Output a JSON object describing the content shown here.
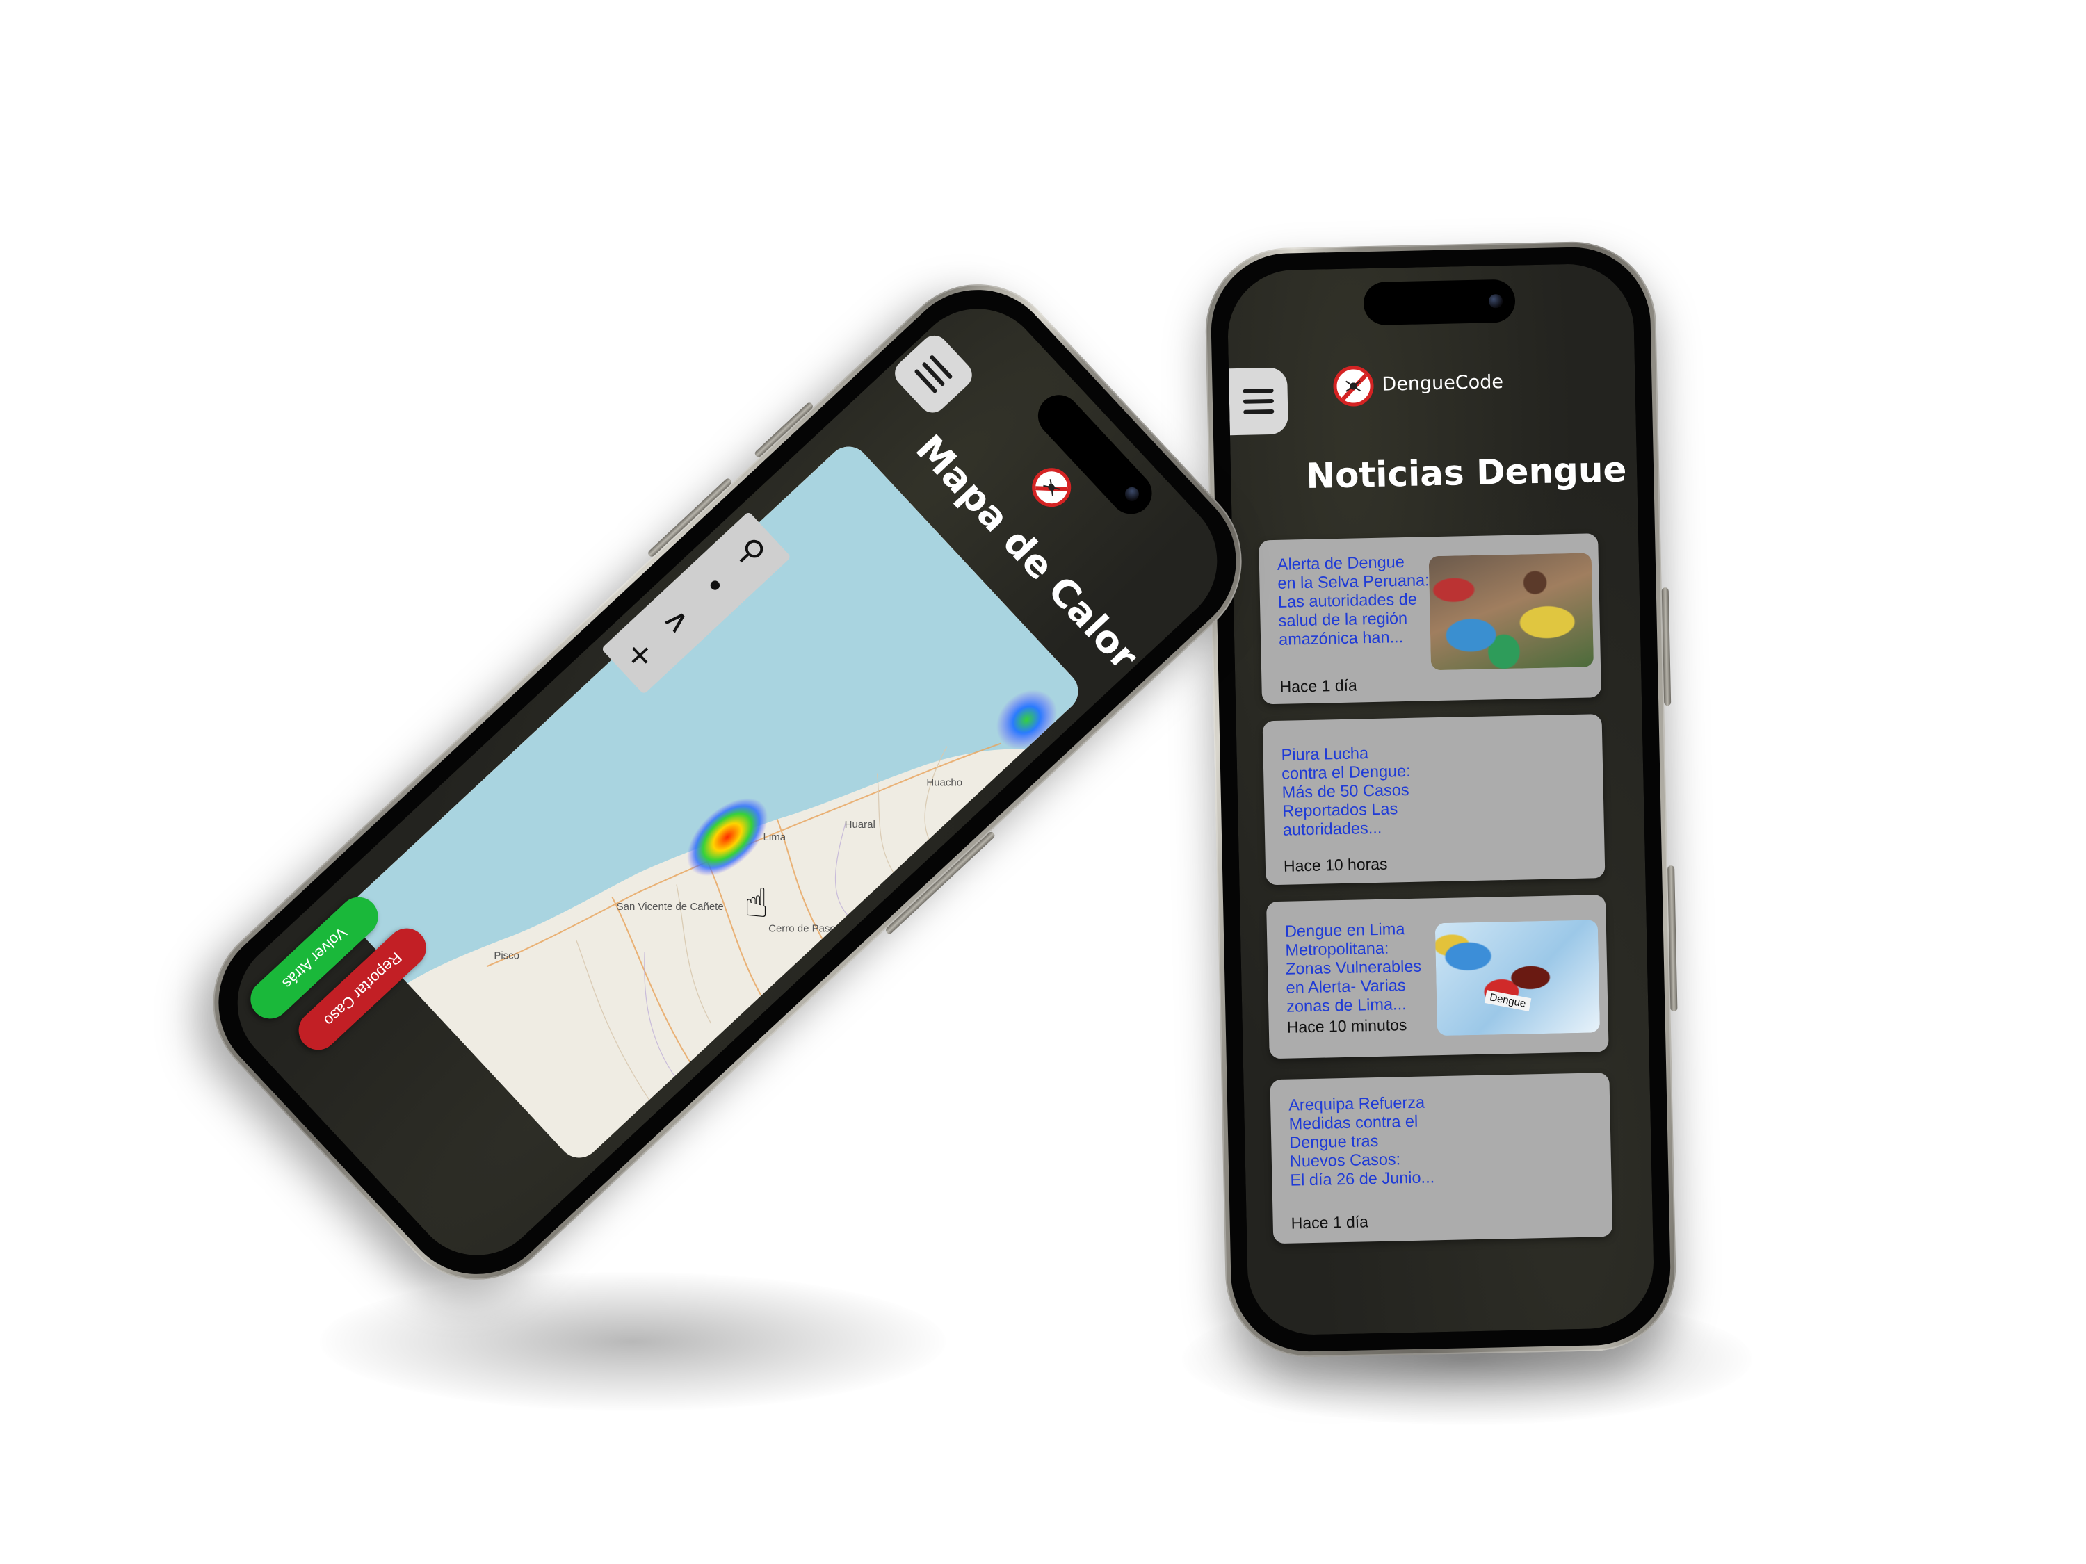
{
  "colors": {
    "screen_bg": "#23231f",
    "card_bg": "#acacac",
    "link_blue": "#1f3bd6",
    "menu_bg": "#d9d9d9",
    "report_red": "#c21f25",
    "back_green": "#1ab83a",
    "water": "#a9d4e0",
    "land": "#efece3"
  },
  "news_screen": {
    "brand": "DengueCode",
    "title": "Noticias Dengue",
    "menu_icon": "hamburger-menu-icon",
    "articles": [
      {
        "title_lines": [
          "Alerta de Dengue",
          "en la Selva Peruana:",
          "Las autoridades de",
          "salud de la región",
          "amazónica han..."
        ],
        "time": "Hace 1 día",
        "has_image": true
      },
      {
        "title_lines": [
          " Piura Lucha",
          "contra el Dengue:",
          "Más de 50 Casos",
          "Reportados Las",
          "autoridades..."
        ],
        "time": "Hace 10 horas",
        "has_image": false
      },
      {
        "title_lines": [
          "Dengue en Lima",
          "Metropolitana:",
          "Zonas Vulnerables",
          "en Alerta- Varias",
          "zonas de Lima..."
        ],
        "time": "Hace 10 minutos",
        "has_image": true,
        "image_caption": "Dengue"
      },
      {
        "title_lines": [
          "Arequipa Refuerza",
          "Medidas contra el",
          "Dengue tras",
          "Nuevos Casos:",
          "El día 26 de Junio..."
        ],
        "time": "Hace 1 día",
        "has_image": false
      }
    ]
  },
  "map_screen": {
    "title": "Mapa de Calor",
    "menu_icon": "hamburger-menu-icon",
    "tools": {
      "zoom_in": "+",
      "up": "∧",
      "person": "•",
      "search": "⚲"
    },
    "city_labels": [
      "Lima",
      "Huacho",
      "Huaral",
      "Cerro de Pasco",
      "San Vicente de Cañete",
      "Pisco"
    ],
    "buttons": {
      "report": "Reportar Caso",
      "back": "Volver Atrás"
    }
  }
}
